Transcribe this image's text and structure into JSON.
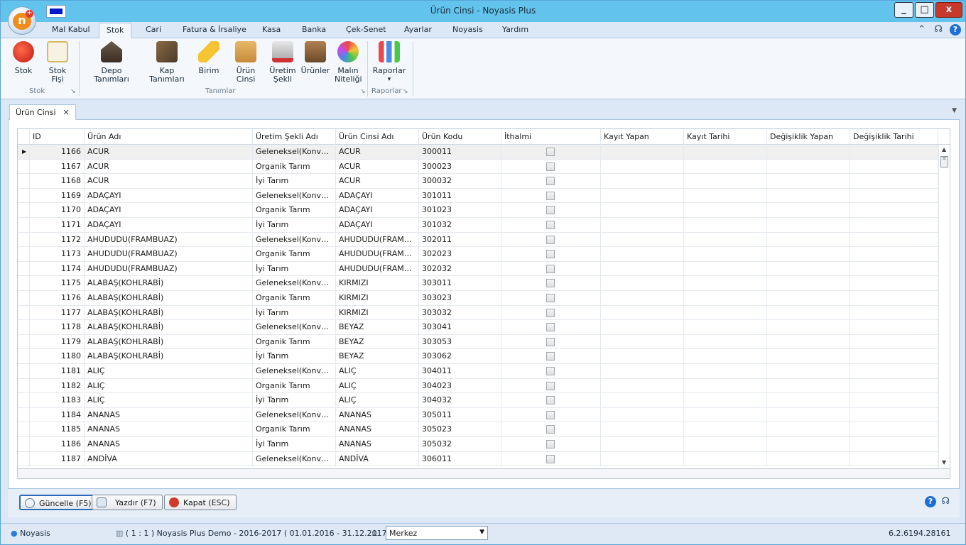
{
  "window": {
    "title": "Ürün Cinsi - Noyasis Plus",
    "min": "_",
    "max": "□",
    "close": "x"
  },
  "menu_tabs": [
    "Mal Kabul",
    "Stok",
    "Cari",
    "Fatura & İrsaliye",
    "Kasa",
    "Banka",
    "Çek-Senet",
    "Ayarlar",
    "Noyasis",
    "Yardım"
  ],
  "active_tab": "Stok",
  "ribbon": {
    "stok": {
      "label": "Stok"
    },
    "stok_fisi": {
      "label": "Stok Fişi"
    },
    "depo": {
      "label": "Depo Tanımları"
    },
    "kap": {
      "label": "Kap Tanımları"
    },
    "birim": {
      "label": "Birim"
    },
    "urun_cinsi": {
      "label": "Ürün Cinsi"
    },
    "uretim": {
      "label1": "Üretim",
      "label2": "Şekli"
    },
    "urunler": {
      "label": "Ürünler"
    },
    "malin": {
      "label1": "Malın",
      "label2": "Niteliği"
    },
    "raporlar": {
      "label": "Raporlar",
      "arrow": "▾"
    },
    "groups": {
      "stok": "Stok",
      "tanimlar": "Tanımlar",
      "raporlar": "Raporlar"
    }
  },
  "doc_tab": {
    "label": "Ürün Cinsi",
    "close": "✕"
  },
  "grid": {
    "columns": [
      "ID",
      "Ürün Adı",
      "Üretim Şekli Adı",
      "Ürün Cinsi Adı",
      "Ürün Kodu",
      "İthalmi",
      "Kayıt Yapan",
      "Kayıt Tarihi",
      "Değişiklik Yapan",
      "Değişiklik Tarihi"
    ],
    "rows": [
      {
        "id": "1166",
        "urun": "ACUR",
        "uretim": "Geleneksel(Konvansiyonel)",
        "cins": "ACUR",
        "kod": "300011"
      },
      {
        "id": "1167",
        "urun": "ACUR",
        "uretim": "Organik Tarım",
        "cins": "ACUR",
        "kod": "300023"
      },
      {
        "id": "1168",
        "urun": "ACUR",
        "uretim": "İyi Tarım",
        "cins": "ACUR",
        "kod": "300032"
      },
      {
        "id": "1169",
        "urun": "ADAÇAYI",
        "uretim": "Geleneksel(Konvansiyonel)",
        "cins": "ADAÇAYI",
        "kod": "301011"
      },
      {
        "id": "1170",
        "urun": "ADAÇAYI",
        "uretim": "Organik Tarım",
        "cins": "ADAÇAYI",
        "kod": "301023"
      },
      {
        "id": "1171",
        "urun": "ADAÇAYI",
        "uretim": "İyi Tarım",
        "cins": "ADAÇAYI",
        "kod": "301032"
      },
      {
        "id": "1172",
        "urun": "AHUDUDU(FRAMBUAZ)",
        "uretim": "Geleneksel(Konvansiyonel)",
        "cins": "AHUDUDU(FRAMBUAZ)",
        "kod": "302011"
      },
      {
        "id": "1173",
        "urun": "AHUDUDU(FRAMBUAZ)",
        "uretim": "Organik Tarım",
        "cins": "AHUDUDU(FRAMBUAZ)",
        "kod": "302023"
      },
      {
        "id": "1174",
        "urun": "AHUDUDU(FRAMBUAZ)",
        "uretim": "İyi Tarım",
        "cins": "AHUDUDU(FRAMBUAZ)",
        "kod": "302032"
      },
      {
        "id": "1175",
        "urun": "ALABAŞ(KOHLRABİ)",
        "uretim": "Geleneksel(Konvansiyonel)",
        "cins": "KIRMIZI",
        "kod": "303011"
      },
      {
        "id": "1176",
        "urun": "ALABAŞ(KOHLRABİ)",
        "uretim": "Organik Tarım",
        "cins": "KIRMIZI",
        "kod": "303023"
      },
      {
        "id": "1177",
        "urun": "ALABAŞ(KOHLRABİ)",
        "uretim": "İyi Tarım",
        "cins": "KIRMIZI",
        "kod": "303032"
      },
      {
        "id": "1178",
        "urun": "ALABAŞ(KOHLRABİ)",
        "uretim": "Geleneksel(Konvansiyonel)",
        "cins": "BEYAZ",
        "kod": "303041"
      },
      {
        "id": "1179",
        "urun": "ALABAŞ(KOHLRABİ)",
        "uretim": "Organik Tarım",
        "cins": "BEYAZ",
        "kod": "303053"
      },
      {
        "id": "1180",
        "urun": "ALABAŞ(KOHLRABİ)",
        "uretim": "İyi Tarım",
        "cins": "BEYAZ",
        "kod": "303062"
      },
      {
        "id": "1181",
        "urun": "ALIÇ",
        "uretim": "Geleneksel(Konvansiyonel)",
        "cins": "ALIÇ",
        "kod": "304011"
      },
      {
        "id": "1182",
        "urun": "ALIÇ",
        "uretim": "Organik Tarım",
        "cins": "ALIÇ",
        "kod": "304023"
      },
      {
        "id": "1183",
        "urun": "ALIÇ",
        "uretim": "İyi Tarım",
        "cins": "ALIÇ",
        "kod": "304032"
      },
      {
        "id": "1184",
        "urun": "ANANAS",
        "uretim": "Geleneksel(Konvansiyonel)",
        "cins": "ANANAS",
        "kod": "305011"
      },
      {
        "id": "1185",
        "urun": "ANANAS",
        "uretim": "Organik Tarım",
        "cins": "ANANAS",
        "kod": "305023"
      },
      {
        "id": "1186",
        "urun": "ANANAS",
        "uretim": "İyi Tarım",
        "cins": "ANANAS",
        "kod": "305032"
      },
      {
        "id": "1187",
        "urun": "ANDİVA",
        "uretim": "Geleneksel(Konvansiyonel)",
        "cins": "ANDİVA",
        "kod": "306011"
      }
    ]
  },
  "buttons": {
    "refresh": "Güncelle (F5)",
    "print": "Yazdır (F7)",
    "close": "Kapat (ESC)"
  },
  "status": {
    "user": "Noyasis",
    "company": "( 1 : 1 ) Noyasis Plus Demo - 2016-2017 ( 01.01.2016 - 31.12.2017 )",
    "branch": "Merkez",
    "version": "6.2.6194.28161"
  }
}
